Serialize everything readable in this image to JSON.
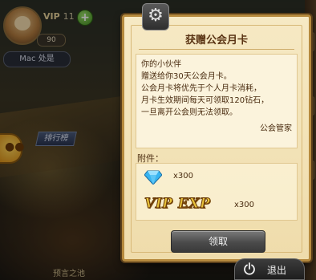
{
  "hud": {
    "vip_label": "VIP",
    "vip_level": "11",
    "level": "90",
    "player_name": "Mac 处是",
    "rank_tag": "排行榜",
    "bottom_label": "预言之池"
  },
  "modal": {
    "title": "获赠公会月卡",
    "message_lines": [
      "你的小伙伴",
      "赠送给你30天公会月卡。",
      "公会月卡将优先于个人月卡消耗，",
      "月卡生效期间每天可领取120钻石，",
      "一旦离开公会则无法领取。"
    ],
    "signature": "公会管家",
    "attachments_label": "附件：",
    "attachments": [
      {
        "icon": "diamond-icon",
        "quantity": "x300"
      },
      {
        "icon": "vip-exp-icon",
        "label": "VIP EXP",
        "quantity": "x300"
      }
    ],
    "claim_button": "领取"
  },
  "exit": {
    "label": "退出",
    "icon": "power-icon"
  },
  "colors": {
    "modal_bg": "#f6e9c4",
    "modal_border": "#b68a3e",
    "text_brown": "#4a2c10",
    "diamond": "#38b4f0",
    "vip_exp_gold": "#e8c23a"
  }
}
